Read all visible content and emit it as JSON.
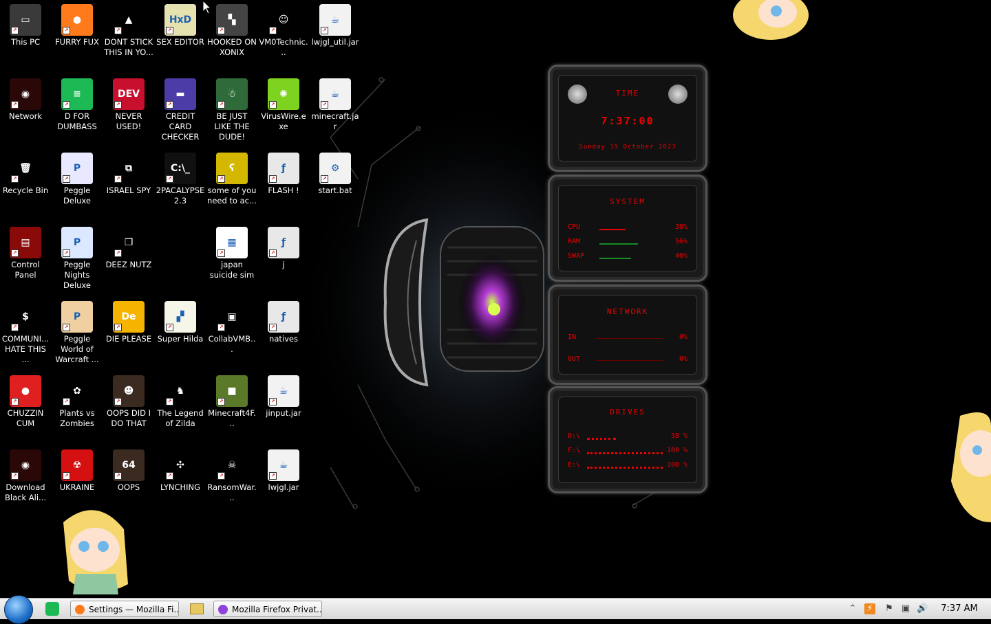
{
  "desktop": {
    "icons": [
      {
        "label": "This PC",
        "name": "this-pc-icon",
        "bg": "#3a3a3a",
        "glyph": "▭"
      },
      {
        "label": "FURRY FUX",
        "name": "firefox-icon",
        "bg": "#ff7a1a",
        "glyph": "●"
      },
      {
        "label": "DONT STICK THIS IN YO...",
        "name": "vlc-cone-icon",
        "bg": "#000000",
        "glyph": "▲"
      },
      {
        "label": "SEX EDITOR",
        "name": "hxd-editor-icon",
        "bg": "#e6e2b0",
        "glyph": "HxD"
      },
      {
        "label": "HOOKED ON XONIX",
        "name": "xonix-game-icon",
        "bg": "#444444",
        "glyph": "▚"
      },
      {
        "label": "VM0Technic...",
        "name": "doctor-icon",
        "bg": "#000000",
        "glyph": "☺"
      },
      {
        "label": "lwjgl_util.jar",
        "name": "java-jar-icon",
        "bg": "#f2f2f2",
        "glyph": "☕"
      },
      {
        "label": "Network",
        "name": "network-alien-icon",
        "bg": "#2a0808",
        "glyph": "◉"
      },
      {
        "label": "D FOR DUMBASS",
        "name": "green-d-app-icon",
        "bg": "#1db954",
        "glyph": "≡"
      },
      {
        "label": "NEVER USED!",
        "name": "devcpp-icon",
        "bg": "#c8102e",
        "glyph": "DEV"
      },
      {
        "label": "CREDIT CARD CHECKER",
        "name": "credit-card-icon",
        "bg": "#4b3ca8",
        "glyph": "▬"
      },
      {
        "label": "BE JUST LIKE THE DUDE!",
        "name": "santa-globe-icon",
        "bg": "#2f6b3a",
        "glyph": "☃"
      },
      {
        "label": "VirusWire.exe",
        "name": "limewire-icon",
        "bg": "#7ed321",
        "glyph": "✺"
      },
      {
        "label": "minecraft.jar",
        "name": "java-jar-icon",
        "bg": "#f2f2f2",
        "glyph": "☕"
      },
      {
        "label": "Recycle Bin",
        "name": "recycle-bin-icon",
        "bg": "#000000",
        "glyph": "🗑"
      },
      {
        "label": "Peggle Deluxe",
        "name": "peggle-icon",
        "bg": "#e8e8ff",
        "glyph": "P"
      },
      {
        "label": "ISRAEL SPY",
        "name": "spy-network-icon",
        "bg": "#000000",
        "glyph": "⧉"
      },
      {
        "label": "2PACALYPSE 2.3",
        "name": "terminal-icon",
        "bg": "#101010",
        "glyph": "C:\\_"
      },
      {
        "label": "some of you need to ac...",
        "name": "beaver-icon",
        "bg": "#d4b800",
        "glyph": "ʕ"
      },
      {
        "label": "FLASH !",
        "name": "flash-document-icon",
        "bg": "#e8e8e8",
        "glyph": "ƒ"
      },
      {
        "label": "start.bat",
        "name": "batch-file-gear-icon",
        "bg": "#f2f2f2",
        "glyph": "⚙"
      },
      {
        "label": "Control Panel",
        "name": "control-panel-icon",
        "bg": "#8a0a0a",
        "glyph": "▤"
      },
      {
        "label": "Peggle Nights Deluxe",
        "name": "peggle-nights-icon",
        "bg": "#dce8ff",
        "glyph": "P"
      },
      {
        "label": "DEEZ NUTZ",
        "name": "stacked-windows-icon",
        "bg": "#000000",
        "glyph": "❐"
      },
      {
        "label": "japan suicide sim",
        "name": "document-icon",
        "bg": "#ffffff",
        "glyph": "▦"
      },
      {
        "label": "j",
        "name": "document-icon",
        "bg": "#e8e8e8",
        "glyph": "ƒ"
      },
      {
        "label": "COMMUNI... HATE THIS ...",
        "name": "money-bag-icon",
        "bg": "#000000",
        "glyph": "$"
      },
      {
        "label": "Peggle World of Warcraft ...",
        "name": "peggle-wow-icon",
        "bg": "#f0d0a0",
        "glyph": "P"
      },
      {
        "label": "DIE PLEASE",
        "name": "dreamweaver-icon",
        "bg": "#f5b400",
        "glyph": "De"
      },
      {
        "label": "Super Hilda",
        "name": "pixel-cat-icon",
        "bg": "#f5f5e8",
        "glyph": "▞"
      },
      {
        "label": "CollabVMB...",
        "name": "monitor-icon",
        "bg": "#000000",
        "glyph": "▣"
      },
      {
        "label": "natives",
        "name": "folder-document-icon",
        "bg": "#e8e8e8",
        "glyph": "ƒ"
      },
      {
        "label": "CHUZZIN CUM",
        "name": "chuzzle-icon",
        "bg": "#e02020",
        "glyph": "●"
      },
      {
        "label": "Plants vs Zombies",
        "name": "pvz-flower-icon",
        "bg": "#000000",
        "glyph": "✿"
      },
      {
        "label": "OOPS DID I DO THAT",
        "name": "portrait-icon",
        "bg": "#3a2a20",
        "glyph": "☻"
      },
      {
        "label": "The Legend of Zilda",
        "name": "pixel-hero-icon",
        "bg": "#000000",
        "glyph": "♞"
      },
      {
        "label": "Minecraft4F...",
        "name": "minecraft-block-icon",
        "bg": "#5a7a2a",
        "glyph": "■"
      },
      {
        "label": "jinput.jar",
        "name": "java-jar-icon",
        "bg": "#f2f2f2",
        "glyph": "☕"
      },
      {
        "label": "Download Black Ali...",
        "name": "alien-head-icon",
        "bg": "#2a0808",
        "glyph": "◉"
      },
      {
        "label": "UKRAINE",
        "name": "radiation-icon",
        "bg": "#d41010",
        "glyph": "☢"
      },
      {
        "label": "OOPS",
        "name": "portrait-64-icon",
        "bg": "#3a2a20",
        "glyph": "64"
      },
      {
        "label": "LYNCHING",
        "name": "knot-icon",
        "bg": "#000000",
        "glyph": "✣"
      },
      {
        "label": "RansomWar...",
        "name": "skull-icon",
        "bg": "#000000",
        "glyph": "☠"
      },
      {
        "label": "lwjgl.jar",
        "name": "java-jar-icon",
        "bg": "#f2f2f2",
        "glyph": "☕"
      }
    ]
  },
  "gadget": {
    "time": {
      "title": "TIME",
      "value": "7:37:00",
      "date": "Sunday 15 October 2023"
    },
    "system": {
      "title": "SYSTEM",
      "rows": [
        {
          "key": "CPU",
          "value": "38%",
          "level": 0.38
        },
        {
          "key": "RAM",
          "value": "56%",
          "level": 0.56
        },
        {
          "key": "SWAP",
          "value": "46%",
          "level": 0.46
        }
      ]
    },
    "network": {
      "title": "NETWORK",
      "rows": [
        {
          "key": "IN",
          "value": "0%"
        },
        {
          "key": "OUT",
          "value": "0%"
        }
      ]
    },
    "drives": {
      "title": "DRIVES",
      "rows": [
        {
          "key": "D:\\",
          "value": "38 %",
          "level": 0.38
        },
        {
          "key": "F:\\",
          "value": "100 %",
          "level": 1.0
        },
        {
          "key": "E:\\",
          "value": "100 %",
          "level": 1.0
        }
      ]
    }
  },
  "taskbar": {
    "buttons": [
      {
        "label": "Settings — Mozilla Fi...",
        "name": "taskbar-firefox-settings"
      },
      {
        "label": "Mozilla Firefox Privat...",
        "name": "taskbar-firefox-private"
      }
    ],
    "clock": "7:37 AM"
  },
  "colors": {
    "accent_red": "#e00000",
    "taskbar_bg": "#e6e6e6",
    "start_blue": "#1e6fc9"
  }
}
